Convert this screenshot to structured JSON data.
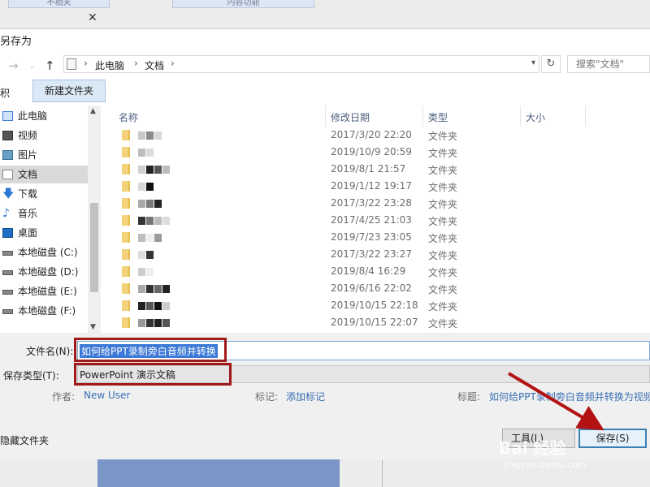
{
  "browser": {
    "tabs": [
      {
        "label": "不相关"
      },
      {
        "label": "内容功能"
      }
    ]
  },
  "dialog": {
    "title": "另存为",
    "breadcrumb": [
      "此电脑",
      "文档"
    ],
    "search_placeholder": "搜索\"文档\"",
    "toolbar": {
      "organize_label": "积",
      "new_folder_label": "新建文件夹"
    },
    "sidebar": {
      "items": [
        {
          "label": "此电脑",
          "icon": "computer-icon"
        },
        {
          "label": "视频",
          "icon": "video-icon"
        },
        {
          "label": "图片",
          "icon": "picture-icon"
        },
        {
          "label": "文档",
          "icon": "document-icon",
          "selected": true
        },
        {
          "label": "下载",
          "icon": "download-icon"
        },
        {
          "label": "音乐",
          "icon": "music-icon"
        },
        {
          "label": "桌面",
          "icon": "desktop-icon"
        },
        {
          "label": "本地磁盘 (C:)",
          "icon": "drive-icon"
        },
        {
          "label": "本地磁盘 (D:)",
          "icon": "drive-icon"
        },
        {
          "label": "本地磁盘 (E:)",
          "icon": "drive-icon"
        },
        {
          "label": "本地磁盘 (F:)",
          "icon": "drive-icon"
        }
      ]
    },
    "columns": {
      "name": "名称",
      "modified": "修改日期",
      "type": "类型",
      "size": "大小"
    },
    "files": [
      {
        "modified": "2017/3/20 22:20",
        "type": "文件夹"
      },
      {
        "modified": "2019/10/9 20:59",
        "type": "文件夹"
      },
      {
        "modified": "2019/8/1 21:57",
        "type": "文件夹"
      },
      {
        "modified": "2019/1/12 19:17",
        "type": "文件夹"
      },
      {
        "modified": "2017/3/22 23:28",
        "type": "文件夹"
      },
      {
        "modified": "2017/4/25 21:03",
        "type": "文件夹"
      },
      {
        "modified": "2019/7/23 23:05",
        "type": "文件夹"
      },
      {
        "modified": "2017/3/22 23:27",
        "type": "文件夹"
      },
      {
        "modified": "2019/8/4 16:29",
        "type": "文件夹"
      },
      {
        "modified": "2019/6/16 22:02",
        "type": "文件夹"
      },
      {
        "modified": "2019/10/15 22:18",
        "type": "文件夹"
      },
      {
        "modified": "2019/10/15 22:07",
        "type": "文件夹"
      }
    ],
    "filename_label": "文件名(N):",
    "filename_value": "如何给PPT录制旁白音频并转换",
    "filetype_label": "保存类型(T):",
    "filetype_value": "PowerPoint 演示文稿",
    "author_key": "作者:",
    "author_value": "New User",
    "tags_key": "标记:",
    "tags_value": "添加标记",
    "title_key": "标题:",
    "title_value": "如何给PPT录制旁白音频并转换为视频",
    "hide_folders_label": "隐藏文件夹",
    "tools_label": "工具(L)",
    "save_label": "保存(S)"
  },
  "watermark": {
    "brand": "Bai 经验",
    "url": "jingyan.baidu.com"
  },
  "colors": {
    "highlight_box": "#a01818",
    "selection": "#3b78d7",
    "link": "#3a6fb5"
  }
}
